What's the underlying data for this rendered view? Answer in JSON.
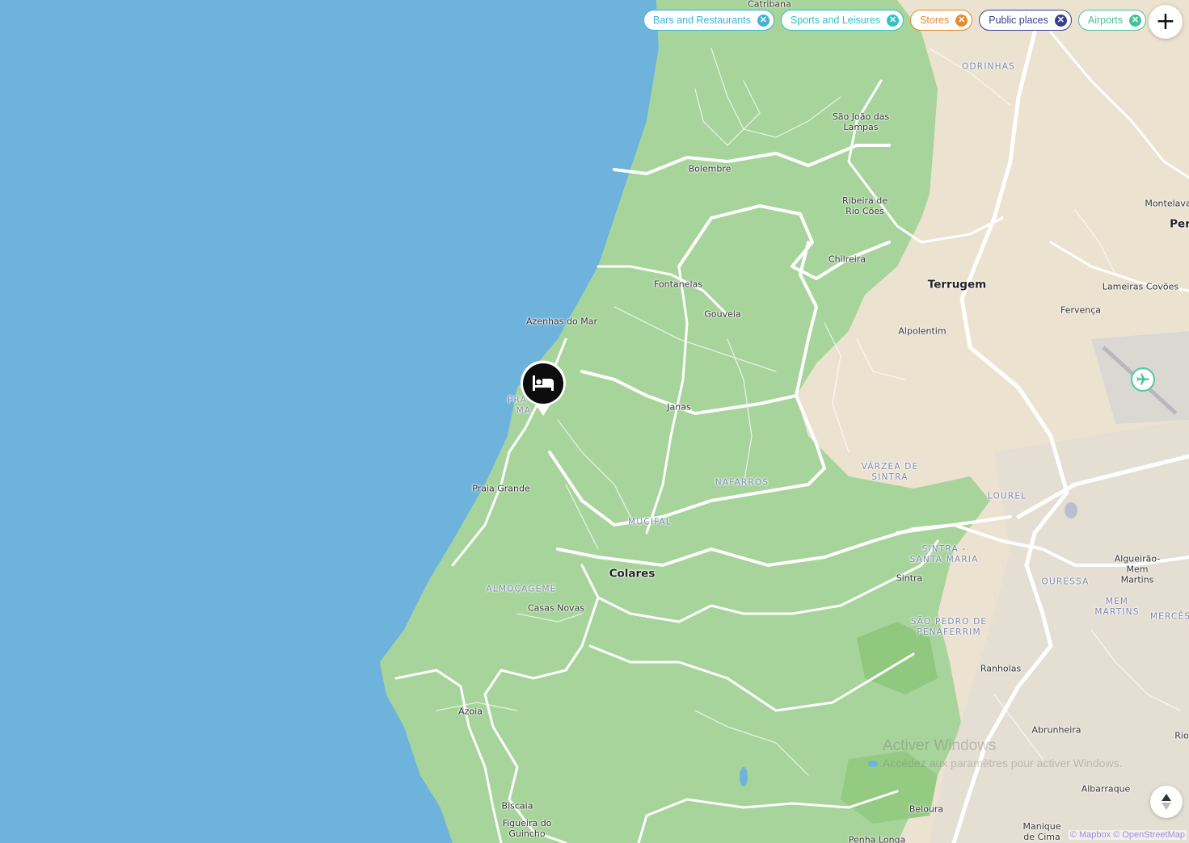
{
  "filters": [
    {
      "label": "Bars and Restaurants",
      "color": "#3cb4d8"
    },
    {
      "label": "Sports and Leisures",
      "color": "#30c2c2"
    },
    {
      "label": "Stores",
      "color": "#e8892b"
    },
    {
      "label": "Public places",
      "color": "#3a3f8f"
    },
    {
      "label": "Airports",
      "color": "#43c39a"
    }
  ],
  "controls": {
    "add_icon": "plus-icon",
    "compass_icon": "compass-north-icon"
  },
  "markers": {
    "hotel_icon": "bed-icon",
    "airport_icon": "airplane-icon"
  },
  "places": {
    "catribana": "Catribana",
    "odrinhas": "ODRINHAS",
    "sao_joao_das_lampas": "São João das\nLampas",
    "bolembre": "Bolembre",
    "ribeira_de_rio_coes": "Ribeira de\nRio Cões",
    "montelavar": "Montelava",
    "pero": "Per",
    "chilreira": "Chilreira",
    "terrugem": "Terrugem",
    "fontanelas": "Fontanelas",
    "lameiras": "Lameiras",
    "covoes": "Covões",
    "gouveia": "Gouveia",
    "fervenca": "Fervença",
    "azenhas_do_mar": "Azenhas do Mar",
    "alpolentim": "Alpolentim",
    "praia_das_macas_a": "PRA",
    "praia_das_macas_b": "MA",
    "janas": "Janas",
    "varzea_de_sintra": "VÁRZEA DE\nSINTRA",
    "praia_grande": "Praia Grande",
    "nafarros": "NAFARROS",
    "lourel": "LOUREL",
    "mucifal": "MUCIFAL",
    "sintra_santa_maria": "SINTRA -\nSANTA MARIA",
    "algueirao": "Algueirão-\nMem Martins",
    "colares": "Colares",
    "sintra": "Sintra",
    "ouressa": "OURESSA",
    "almocageme": "ALMOÇAGEME",
    "mem_martins": "MEM\nMARTINS",
    "merces": "MERCÊS",
    "casas_novas": "Casas Novas",
    "sao_pedro_de_penaferrim": "SÃO PEDRO DE\nPENAFERRIM",
    "ranholas": "Ranholas",
    "azoia": "Azoia",
    "abrunheira": "Abrunheira",
    "rio": "Rio",
    "albarraque": "Albarraque",
    "biscaia": "Biscaia",
    "beloura": "Beloura",
    "figueira_do_guincho": "Figueira do\nGuincho",
    "manique_de_cima": "Manique\nde Cima",
    "penha_longa": "Penha Longa"
  },
  "attribution": "© Mapbox © OpenStreetMap",
  "watermark": {
    "title": "Activer Windows",
    "subtitle": "Accédez aux paramètres pour activer Windows."
  }
}
